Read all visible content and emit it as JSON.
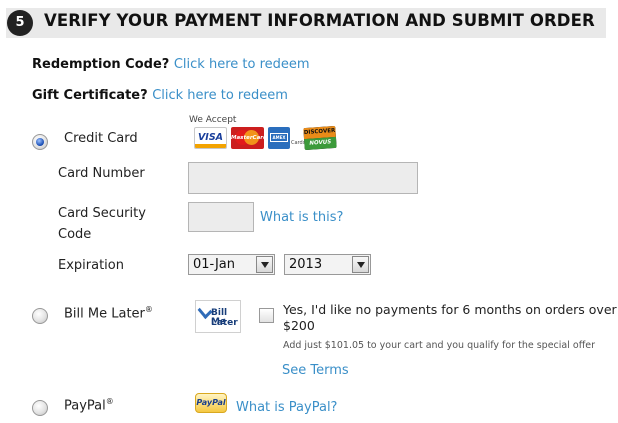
{
  "header": {
    "step_number": "5",
    "title": "VERIFY YOUR PAYMENT INFORMATION AND SUBMIT ORDER"
  },
  "redemption": {
    "label": "Redemption Code?",
    "link": "Click here to redeem"
  },
  "gift_certificate": {
    "label": "Gift Certificate?",
    "link": "Click here to redeem"
  },
  "credit_card": {
    "label": "Credit Card",
    "selected": true,
    "we_accept": "We Accept",
    "cards": [
      {
        "name": "VISA",
        "icon": "visa-logo"
      },
      {
        "name": "MasterCard",
        "icon": "mastercard-logo"
      },
      {
        "name": "American Express Cards",
        "icon": "amex-logo"
      },
      {
        "name": "DISCOVER NOVUS",
        "icon": "discover-logo"
      }
    ],
    "card_number_label": "Card Number",
    "card_number_value": "",
    "security_label_line1": "Card Security",
    "security_label_line2": "Code",
    "security_value": "",
    "what_is_this": "What is this?",
    "expiration_label": "Expiration",
    "exp_month": "01-Jan",
    "exp_year": "2013"
  },
  "bill_me_later": {
    "label": "Bill Me Later",
    "reg_mark": "®",
    "logo_text_line1": "Bill Me",
    "logo_text_line2": "Later",
    "offer_line1": "Yes, I'd like no payments for 6 months on orders over",
    "offer_line2": "$200",
    "note": "Add just $101.05 to your cart and you qualify for the special offer",
    "see_terms": "See Terms",
    "checked": false
  },
  "paypal": {
    "label": "PayPal",
    "reg_mark": "®",
    "logo_text": "PayPal",
    "what_is_paypal": "What is PayPal?"
  },
  "colors": {
    "link": "#3a8fc8",
    "header_bg": "#e9e9e9",
    "step_circle": "#222222"
  }
}
